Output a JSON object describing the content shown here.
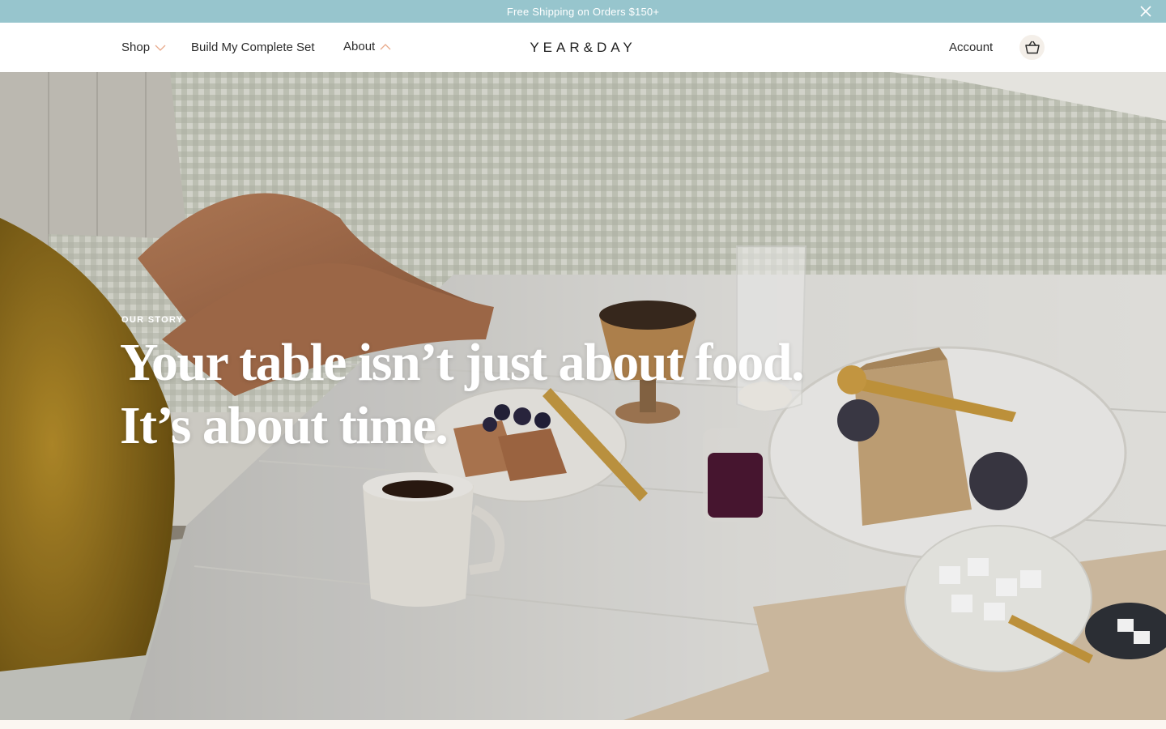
{
  "promo": {
    "text": "Free Shipping on Orders $150+",
    "background": "#97c5cd"
  },
  "nav": {
    "shop_label": "Shop",
    "build_set_label": "Build My Complete Set",
    "about_label": "About",
    "account_label": "Account",
    "brand": "YEAR&DAY",
    "accent": "#e8a98a"
  },
  "hero": {
    "eyebrow": "OUR STORY",
    "headline_line1": "Your table isn’t just about food.",
    "headline_line2": "It’s about time."
  },
  "icons": {
    "close": "close-icon",
    "shop_chevron": "chevron-down-icon",
    "about_chevron": "chevron-up-icon",
    "cart": "basket-icon"
  }
}
